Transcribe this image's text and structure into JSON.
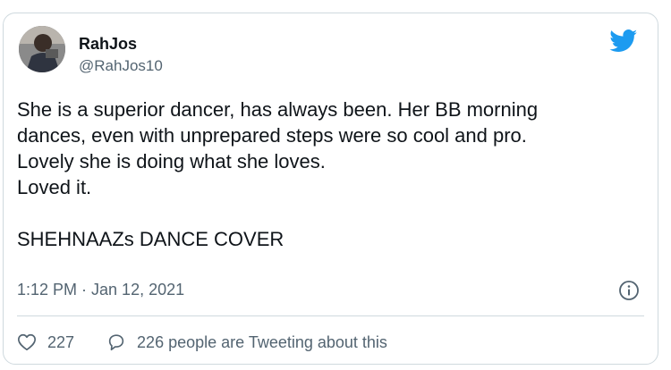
{
  "user": {
    "name": "RahJos",
    "handle": "@RahJos10"
  },
  "tweet": {
    "lines": [
      "She is a superior dancer, has always been. Her BB morning",
      "dances, even with unprepared steps were so cool and pro.",
      "Lovely she is doing what she loves.",
      "Loved it.",
      "",
      "SHEHNAAZs DANCE COVER"
    ],
    "timestamp": "1:12 PM · Jan 12, 2021"
  },
  "actions": {
    "like_count": "227",
    "reply_text": "226 people are Tweeting about this"
  },
  "colors": {
    "twitter_blue": "#1d9bf0",
    "text_primary": "#0f1419",
    "text_secondary": "#536471",
    "border": "#cfd9de"
  },
  "icons": {
    "brand": "twitter-bird-icon",
    "info": "info-icon",
    "like": "heart-icon",
    "reply": "speech-bubble-icon"
  }
}
